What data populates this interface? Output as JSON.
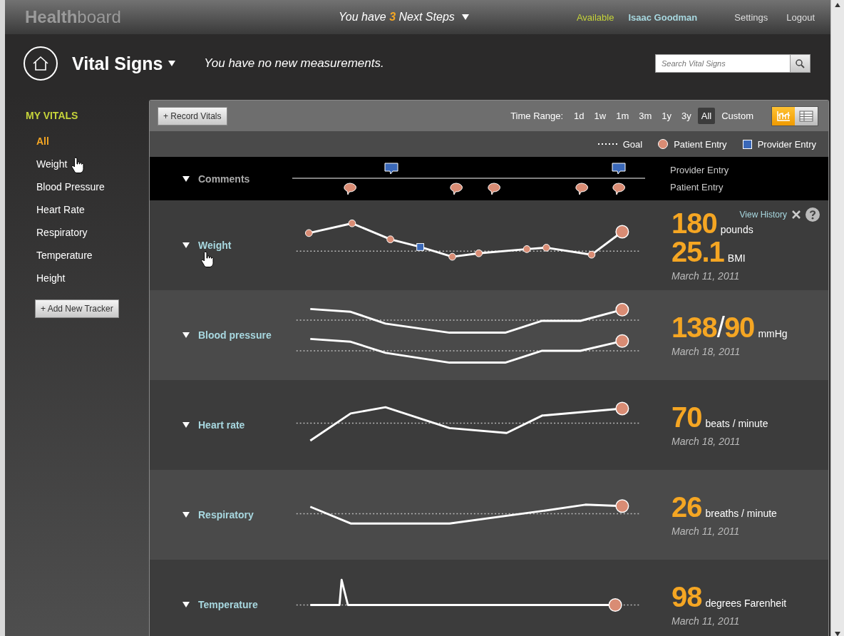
{
  "header": {
    "logo_bold": "Health",
    "logo_light": "board",
    "next_steps": {
      "before": "You have ",
      "count": "3",
      "after": " Next Steps"
    },
    "status": "Available",
    "user": "Isaac Goodman",
    "links": [
      "Settings",
      "Logout"
    ]
  },
  "page": {
    "title": "Vital Signs",
    "message": "You have no new measurements.",
    "search": {
      "placeholder": "Search Vital Signs"
    }
  },
  "sidebar": {
    "heading": "MY VITALS",
    "items": [
      {
        "label": "All",
        "selected": true
      },
      {
        "label": "Weight",
        "selected": false
      },
      {
        "label": "Blood Pressure",
        "selected": false
      },
      {
        "label": "Heart Rate",
        "selected": false
      },
      {
        "label": "Respiratory",
        "selected": false
      },
      {
        "label": "Temperature",
        "selected": false
      },
      {
        "label": "Height",
        "selected": false
      }
    ],
    "add_button": "+ Add New Tracker"
  },
  "toolbar": {
    "record_button": "+ Record Vitals",
    "time_range_label": "Time Range:",
    "ranges": [
      {
        "label": "1d",
        "selected": false
      },
      {
        "label": "1w",
        "selected": false
      },
      {
        "label": "1m",
        "selected": false
      },
      {
        "label": "3m",
        "selected": false
      },
      {
        "label": "1y",
        "selected": false
      },
      {
        "label": "3y",
        "selected": false
      },
      {
        "label": "All",
        "selected": true
      },
      {
        "label": "Custom",
        "selected": false
      }
    ],
    "views": [
      {
        "kind": "chart",
        "selected": true
      },
      {
        "kind": "table",
        "selected": false
      }
    ]
  },
  "legend": [
    {
      "kind": "goal",
      "label": "Goal"
    },
    {
      "kind": "patient",
      "label": "Patient Entry"
    },
    {
      "kind": "provider",
      "label": "Provider Entry"
    }
  ],
  "comments": {
    "label": "Comments",
    "rows": [
      "Provider Entry",
      "Patient Entry"
    ]
  },
  "trackers": [
    {
      "name": "Weight",
      "readings": [
        {
          "parts": [
            "180"
          ],
          "unit": "pounds"
        },
        {
          "parts": [
            "25.1"
          ],
          "unit": "BMI"
        }
      ],
      "date": "March 11, 2011",
      "history_link": "View History"
    },
    {
      "name": "Blood pressure",
      "readings": [
        {
          "parts": [
            "138",
            "/",
            "90"
          ],
          "unit": "mmHg"
        }
      ],
      "date": "March 18, 2011"
    },
    {
      "name": "Heart rate",
      "readings": [
        {
          "parts": [
            "70"
          ],
          "unit": "beats / minute"
        }
      ],
      "date": "March 18, 2011"
    },
    {
      "name": "Respiratory",
      "readings": [
        {
          "parts": [
            "26"
          ],
          "unit": "breaths / minute"
        }
      ],
      "date": "March 11, 2011"
    },
    {
      "name": "Temperature",
      "readings": [
        {
          "parts": [
            "98"
          ],
          "unit": "degrees Farenheit"
        }
      ],
      "date": "March 11, 2011"
    }
  ]
}
